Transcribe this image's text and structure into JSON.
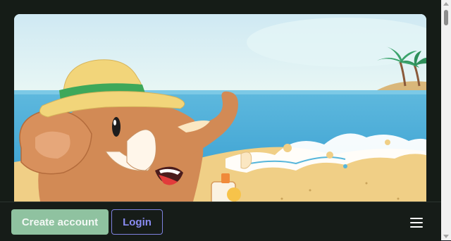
{
  "hero": {
    "image": "beach-elephant-illustration"
  },
  "footer": {
    "create_account_label": "Create account",
    "login_label": "Login",
    "menu_icon": "hamburger-menu-icon"
  },
  "colors": {
    "background": "#151c17",
    "create_button": "#8fc2a0",
    "login_accent": "#8a8cf2"
  }
}
